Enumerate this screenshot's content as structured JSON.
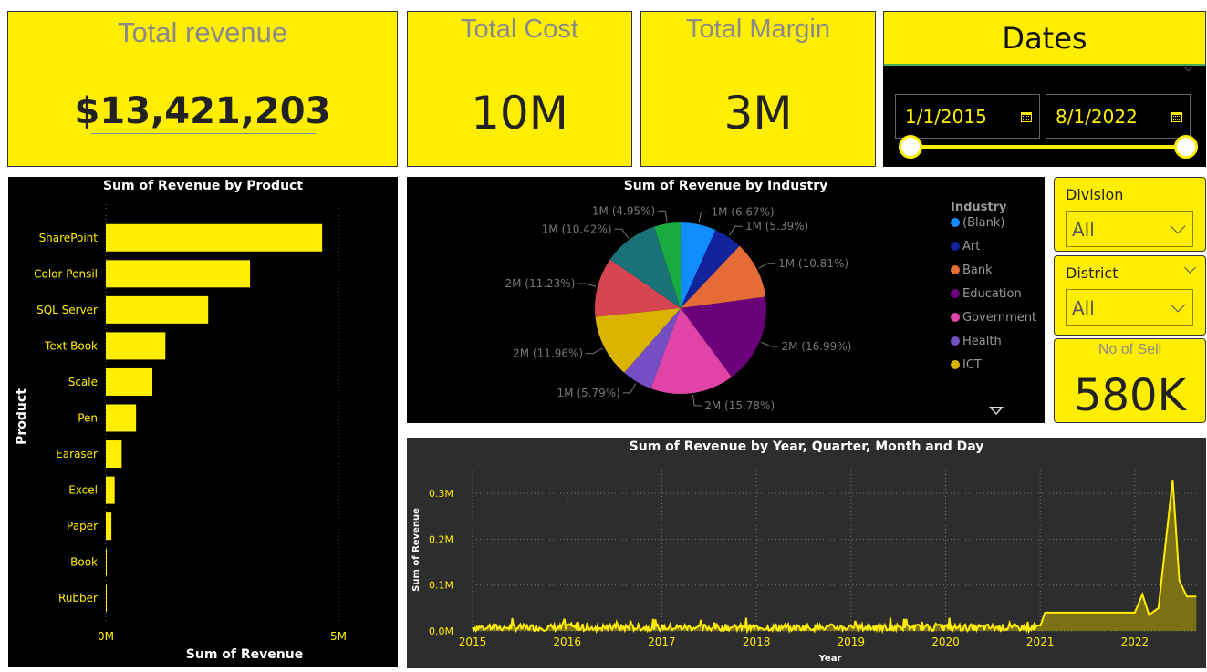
{
  "kpis": {
    "revenue": {
      "title": "Total revenue",
      "value": "$13,421,203"
    },
    "cost": {
      "title": "Total Cost",
      "value": "10M"
    },
    "margin": {
      "title": "Total Margin",
      "value": "3M"
    },
    "sell": {
      "title": "No of Sell",
      "value": "580K"
    }
  },
  "dates": {
    "title": "Dates",
    "start": "1/1/2015",
    "end": "8/1/2022"
  },
  "slicers": {
    "division": {
      "title": "Division",
      "value": "All"
    },
    "district": {
      "title": "District",
      "value": "All"
    }
  },
  "colors": {
    "accent": "#ffee00",
    "background": "#000000",
    "line_panel": "#2d2d2d"
  },
  "chart_data": [
    {
      "type": "bar",
      "orientation": "horizontal",
      "title": "Sum of Revenue by Product",
      "xlabel": "Sum of Revenue",
      "ylabel": "Product",
      "xlim": [
        0,
        5000000
      ],
      "xticks": [
        "0M",
        "5M"
      ],
      "categories": [
        "SharePoint",
        "Color Pensil",
        "SQL Server",
        "Text Book",
        "Scale",
        "Pen",
        "Earaser",
        "Excel",
        "Paper",
        "Book",
        "Rubber"
      ],
      "values": [
        4650000,
        3100000,
        2200000,
        1280000,
        1000000,
        650000,
        340000,
        190000,
        120000,
        20000,
        15000
      ],
      "color": "#ffee00"
    },
    {
      "type": "pie",
      "title": "Sum of Revenue by Industry",
      "legend_title": "Industry",
      "legend_position": "right",
      "slices": [
        {
          "name": "(Blank)",
          "pct": 6.67,
          "label": "1M (6.67%)",
          "color": "#118dff"
        },
        {
          "name": "Art",
          "pct": 5.39,
          "label": "1M (5.39%)",
          "color": "#12239e"
        },
        {
          "name": "Bank",
          "pct": 10.81,
          "label": "1M (10.81%)",
          "color": "#e66c37"
        },
        {
          "name": "Education",
          "pct": 16.99,
          "label": "2M (16.99%)",
          "color": "#6b007b"
        },
        {
          "name": "Government",
          "pct": 15.78,
          "label": "2M (15.78%)",
          "color": "#e044a7"
        },
        {
          "name": "Health",
          "pct": 5.79,
          "label": "1M (5.79%)",
          "color": "#744ec2"
        },
        {
          "name": "ICT",
          "pct": 11.96,
          "label": "2M (11.96%)",
          "color": "#d9b300"
        },
        {
          "name": "",
          "pct": 11.23,
          "label": "2M (11.23%)",
          "color": "#d64550"
        },
        {
          "name": "",
          "pct": 10.42,
          "label": "1M (10.42%)",
          "color": "#197278"
        },
        {
          "name": "",
          "pct": 4.95,
          "label": "1M (4.95%)",
          "color": "#1aab40"
        }
      ]
    },
    {
      "type": "area",
      "title": "Sum of Revenue by Year, Quarter, Month and Day",
      "xlabel": "Year",
      "ylabel": "Sum of Revenue",
      "x_ticks": [
        "2015",
        "2016",
        "2017",
        "2018",
        "2019",
        "2020",
        "2021",
        "2022"
      ],
      "y_ticks": [
        "0.0M",
        "0.1M",
        "0.2M",
        "0.3M"
      ],
      "ylim": [
        0,
        0.34
      ],
      "baseline_noise_max": 0.03,
      "series": [
        {
          "x": [
            2021.0,
            2021.05,
            2022.0,
            2022.08,
            2022.15,
            2022.25,
            2022.33,
            2022.4,
            2022.47,
            2022.55,
            2022.65
          ],
          "y": [
            0.01,
            0.04,
            0.04,
            0.08,
            0.035,
            0.05,
            0.2,
            0.33,
            0.11,
            0.075,
            0.075
          ]
        }
      ]
    }
  ]
}
